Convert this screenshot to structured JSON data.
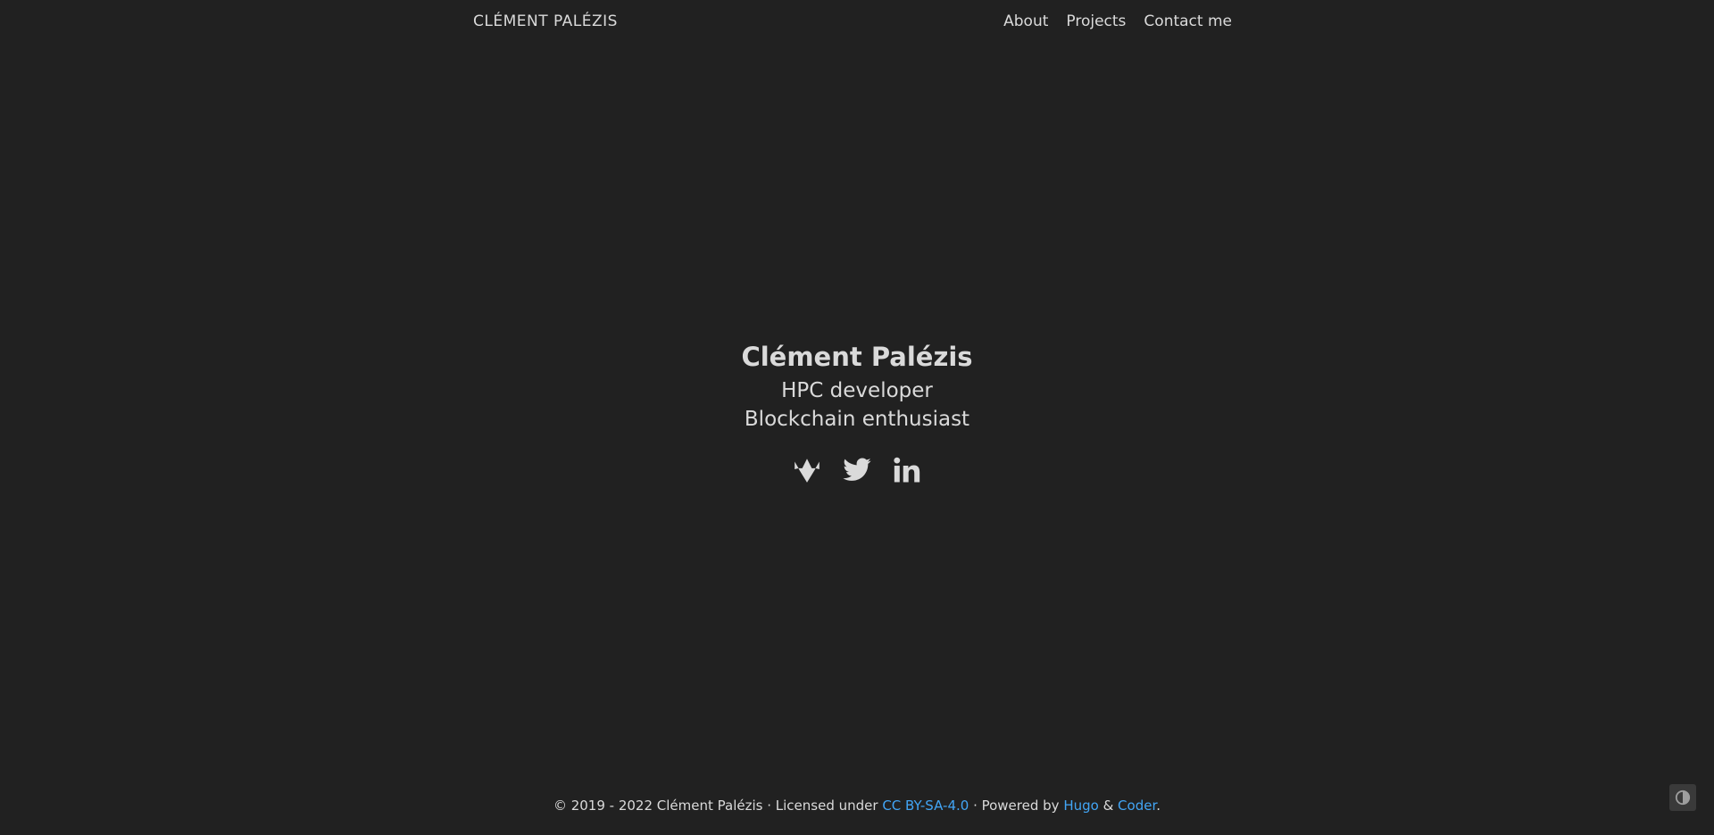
{
  "navbar": {
    "brand": "CLÉMENT PALÉZIS",
    "links": [
      {
        "label": "About"
      },
      {
        "label": "Projects"
      },
      {
        "label": "Contact me"
      }
    ]
  },
  "hero": {
    "name": "Clément Palézis",
    "tagline_lines": [
      "HPC developer",
      "Blockchain enthusiast"
    ],
    "social": [
      {
        "icon": "gitlab-icon"
      },
      {
        "icon": "twitter-icon"
      },
      {
        "icon": "linkedin-icon"
      }
    ]
  },
  "footer": {
    "copyright": "© 2019 - 2022 Clément Palézis · Licensed under ",
    "license_link": "CC BY-SA-4.0",
    "powered_by": " · Powered by ",
    "hugo_link": "Hugo",
    "amp": " & ",
    "coder_link": "Coder",
    "period": "."
  },
  "theme_toggle": {
    "icon": "contrast-icon"
  },
  "colors": {
    "background": "#212121",
    "text": "#dadada",
    "link": "#42a5f5"
  }
}
